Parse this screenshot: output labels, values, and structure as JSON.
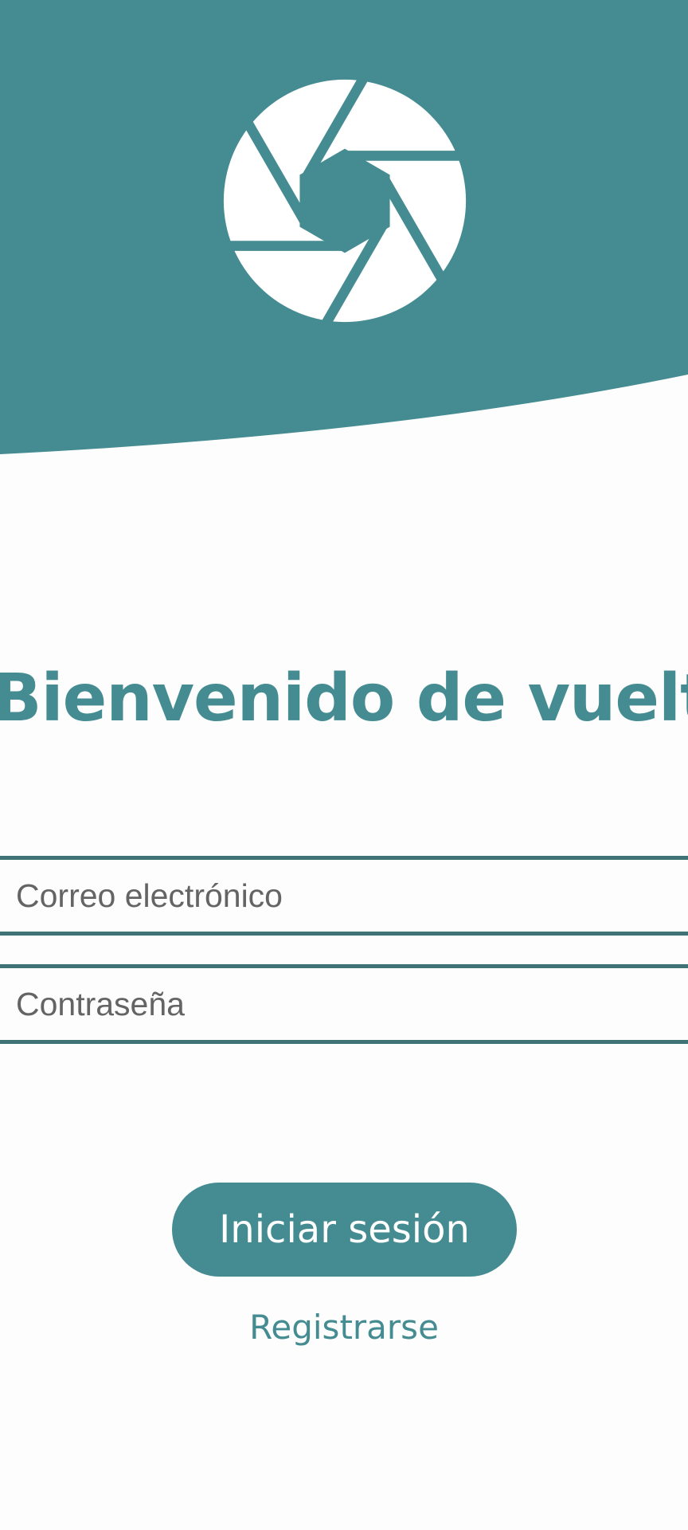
{
  "theme": {
    "accent": "#448c91",
    "field_border": "#3f7378",
    "background": "#fdfdfd"
  },
  "header": {
    "logo_icon": "camera-aperture-icon"
  },
  "main": {
    "title": "Bienvenido de vuelta",
    "email_placeholder": "Correo electrónico",
    "password_placeholder": "Contraseña",
    "login_label": "Iniciar sesión",
    "register_label": "Registrarse"
  }
}
